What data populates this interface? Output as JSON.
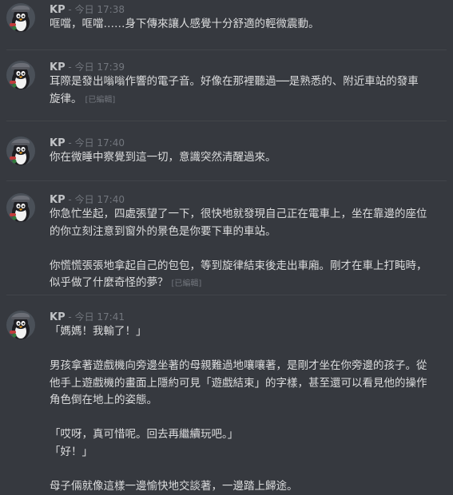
{
  "messages": [
    {
      "author": "KP",
      "separator": " - ",
      "timestamp": "今日 17:38",
      "paragraphs": [
        {
          "lines": [
            "哐噹，哐噹……身下傳來讓人感覺十分舒適的輕微震動。"
          ],
          "edited": ""
        }
      ]
    },
    {
      "author": "KP",
      "separator": " - ",
      "timestamp": "今日 17:39",
      "paragraphs": [
        {
          "lines": [
            "耳際是發出嗡嗡作響的電子音。好像在那裡聽過──是熟悉的、附近車站的發車",
            "旋律。"
          ],
          "edited": "[已編輯]"
        }
      ]
    },
    {
      "author": "KP",
      "separator": " - ",
      "timestamp": "今日 17:40",
      "paragraphs": [
        {
          "lines": [
            "你在微睡中察覺到這一切，意識突然清醒過來。"
          ],
          "edited": ""
        }
      ]
    },
    {
      "author": "KP",
      "separator": " - ",
      "timestamp": "今日 17:40",
      "paragraphs": [
        {
          "lines": [
            "你急忙坐起，四處張望了一下，很快地就發現自己正在電車上，坐在靠邊的座位",
            "的你立刻注意到窗外的景色是你要下車的車站。"
          ],
          "edited": ""
        },
        {
          "lines": [
            "你慌慌張張地拿起自己的包包，等到旋律結束後走出車廂。剛才在車上打盹時，",
            "似乎做了什麼奇怪的夢？"
          ],
          "edited": "[已編輯]"
        }
      ]
    },
    {
      "author": "KP",
      "separator": " - ",
      "timestamp": "今日 17:41",
      "paragraphs": [
        {
          "lines": [
            "「媽媽！我輸了！」"
          ],
          "edited": ""
        },
        {
          "lines": [
            "男孩拿著遊戲機向旁邊坐著的母親難過地嚷嚷著，是剛才坐在你旁邊的孩子。從",
            "他手上遊戲機的畫面上隱約可見「遊戲結束」的字樣，甚至還可以看見他的操作",
            "角色倒在地上的姿態。"
          ],
          "edited": ""
        },
        {
          "lines": [
            "「哎呀，真可惜呢。回去再繼續玩吧。」",
            "「好！」"
          ],
          "edited": ""
        },
        {
          "lines": [
            "母子倆就像這樣一邊愉快地交談著，一邊踏上歸途。"
          ],
          "edited": ""
        }
      ]
    }
  ]
}
